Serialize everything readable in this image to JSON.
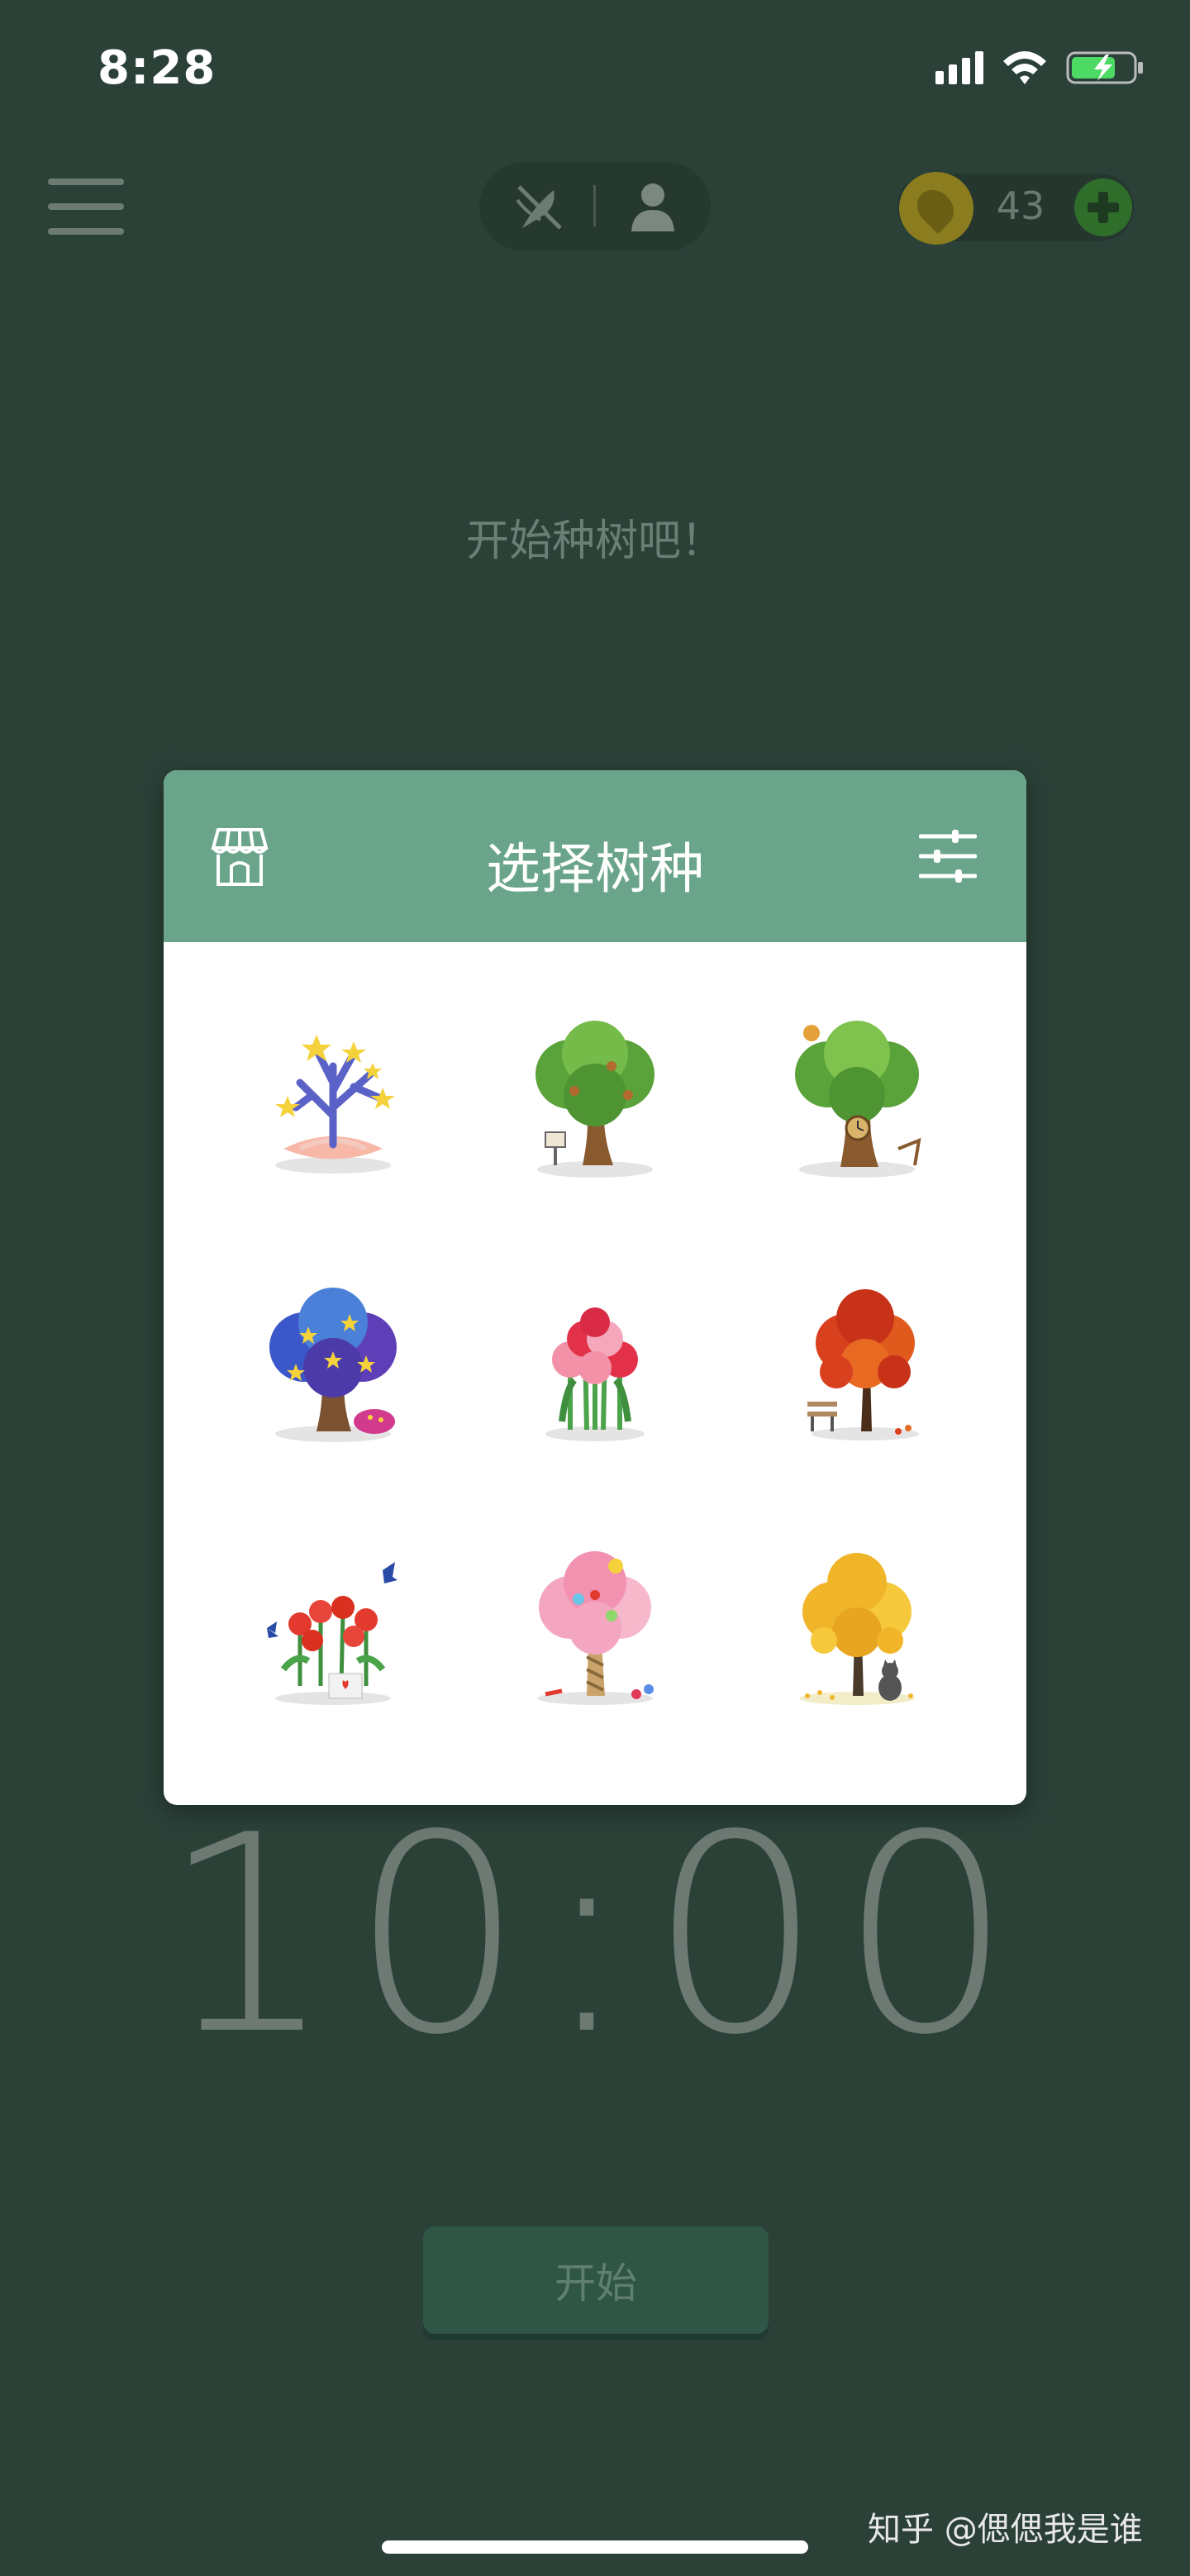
{
  "status_bar": {
    "time": "8:28",
    "signal_icon": "cellular-signal-icon",
    "wifi_icon": "wifi-icon",
    "battery_icon": "battery-charging-icon"
  },
  "top_bar": {
    "menu_icon": "hamburger-menu-icon",
    "mode_toggle": {
      "plant_icon": "plant-mode-icon",
      "person_icon": "person-icon"
    },
    "coins": {
      "count": "43",
      "coin_icon": "seed-coin-icon",
      "add_icon": "add-coins-icon"
    }
  },
  "main": {
    "prompt": "开始种树吧！",
    "timer": "10:00",
    "start_label": "开始"
  },
  "dialog": {
    "title": "选择树种",
    "shop_icon": "shop-icon",
    "filter_icon": "sliders-icon",
    "trees": [
      {
        "icon": "coral-star-tree-icon"
      },
      {
        "icon": "mailbox-oak-tree-icon"
      },
      {
        "icon": "clock-treehouse-icon"
      },
      {
        "icon": "starry-night-tree-icon"
      },
      {
        "icon": "carnation-bouquet-icon"
      },
      {
        "icon": "red-maple-bench-icon"
      },
      {
        "icon": "rose-butterfly-pot-icon"
      },
      {
        "icon": "candy-tree-icon"
      },
      {
        "icon": "ginkgo-cat-tree-icon"
      }
    ]
  },
  "watermark": "知乎 @偲偲我是谁",
  "colors": {
    "background": "#2b4138",
    "dialog_header": "#6aa58b",
    "start_button": "#2e5546"
  }
}
